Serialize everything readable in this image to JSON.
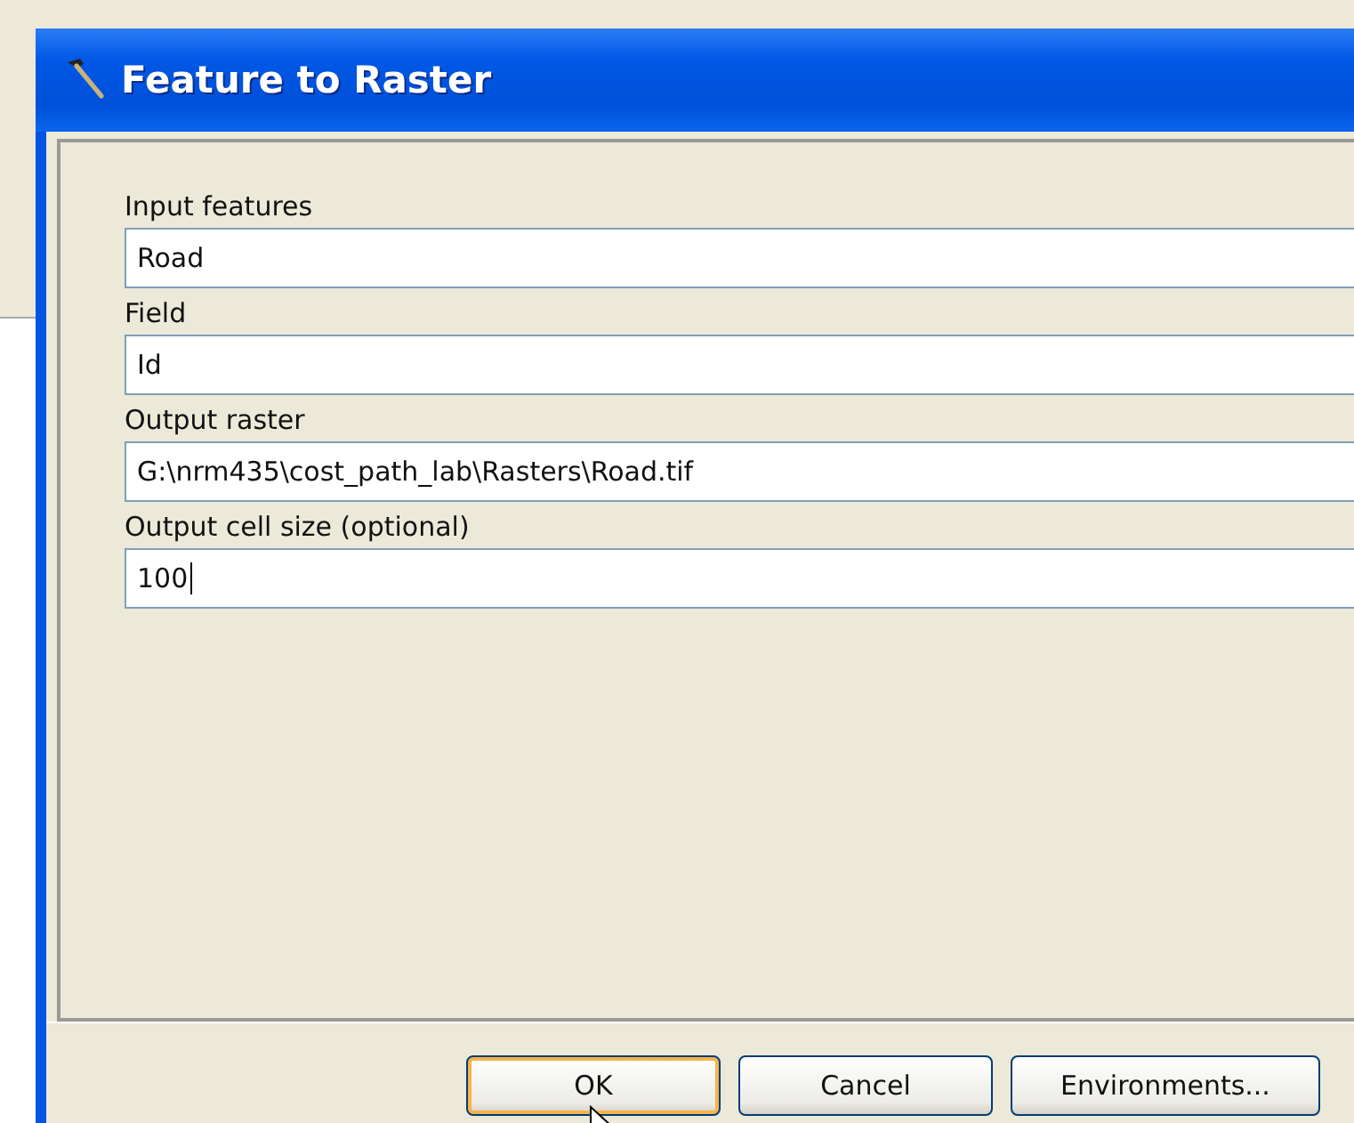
{
  "window": {
    "title": "Feature to Raster"
  },
  "fields": [
    {
      "label": "Input features",
      "value": "Road",
      "caret": false
    },
    {
      "label": "Field",
      "value": "Id",
      "caret": false
    },
    {
      "label": "Output raster",
      "value": "G:\\nrm435\\cost_path_lab\\Rasters\\Road.tif",
      "caret": false
    },
    {
      "label": "Output cell size (optional)",
      "value": "100",
      "caret": true
    }
  ],
  "buttons": [
    {
      "label": "OK",
      "default": true
    },
    {
      "label": "Cancel",
      "default": false
    },
    {
      "label": "Environments...",
      "default": false
    }
  ]
}
